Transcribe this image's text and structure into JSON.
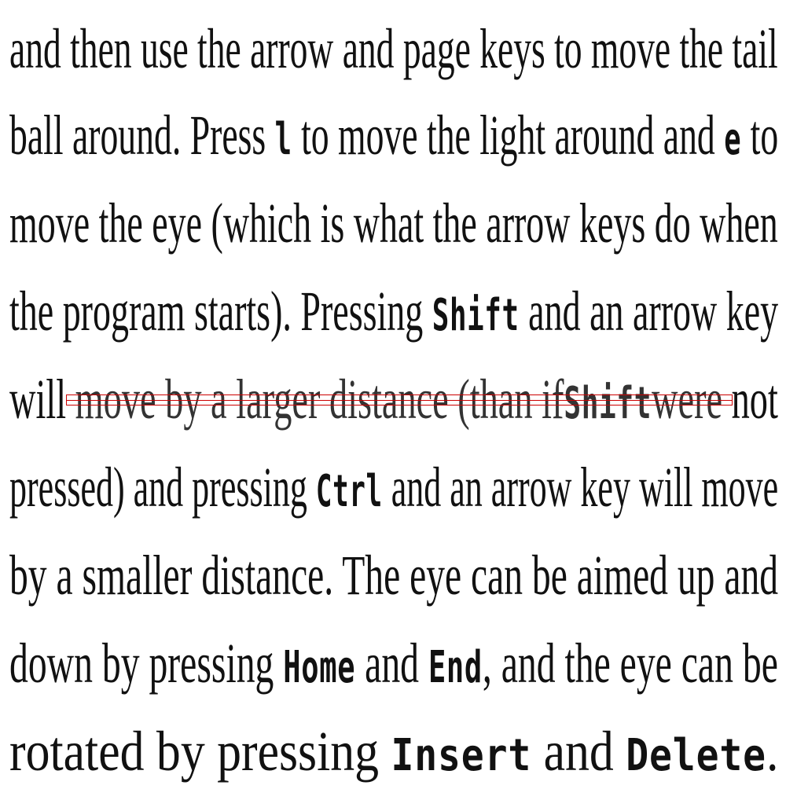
{
  "lines": [
    {
      "segments": [
        {
          "text": "and then use the arrow and page keys to move the tail",
          "mono": false
        }
      ]
    },
    {
      "segments": [
        {
          "text": "ball around.  Press ",
          "mono": false
        },
        {
          "text": "l",
          "mono": true
        },
        {
          "text": " to move the light around and ",
          "mono": false
        },
        {
          "text": "e",
          "mono": true
        },
        {
          "text": " to",
          "mono": false
        }
      ]
    },
    {
      "segments": [
        {
          "text": "move the eye (which is what the arrow keys do when",
          "mono": false
        }
      ]
    },
    {
      "segments": [
        {
          "text": "the program starts).  Pressing ",
          "mono": false
        },
        {
          "text": "Shift",
          "mono": true
        },
        {
          "text": " and an arrow key",
          "mono": false
        }
      ]
    },
    {
      "segments": [
        {
          "text": "will ",
          "mono": false
        },
        {
          "text": "move by a larger distance (than if ",
          "mono": false,
          "struck": true
        },
        {
          "text": "Shift",
          "mono": true,
          "struck": true
        },
        {
          "text": " were",
          "mono": false,
          "struck": true
        },
        {
          "text": " not",
          "mono": false
        }
      ]
    },
    {
      "segments": [
        {
          "text": "pressed) and pressing ",
          "mono": false
        },
        {
          "text": "Ctrl",
          "mono": true
        },
        {
          "text": " and an arrow key will move",
          "mono": false
        }
      ]
    },
    {
      "segments": [
        {
          "text": "by a smaller distance.  The eye can be aimed up and",
          "mono": false
        }
      ]
    },
    {
      "segments": [
        {
          "text": "down by pressing ",
          "mono": false
        },
        {
          "text": "Home",
          "mono": true
        },
        {
          "text": " and ",
          "mono": false
        },
        {
          "text": "End",
          "mono": true
        },
        {
          "text": ", and the eye can be",
          "mono": false
        }
      ]
    },
    {
      "segments": [
        {
          "text": "rotated by pressing ",
          "mono": false
        },
        {
          "text": "Insert",
          "mono": true
        },
        {
          "text": " and ",
          "mono": false
        },
        {
          "text": "Delete",
          "mono": true
        },
        {
          "text": ".",
          "mono": false
        }
      ]
    }
  ],
  "colors": {
    "text": "#111111",
    "strike_annotation": "#cc0000",
    "background": "#ffffff"
  }
}
